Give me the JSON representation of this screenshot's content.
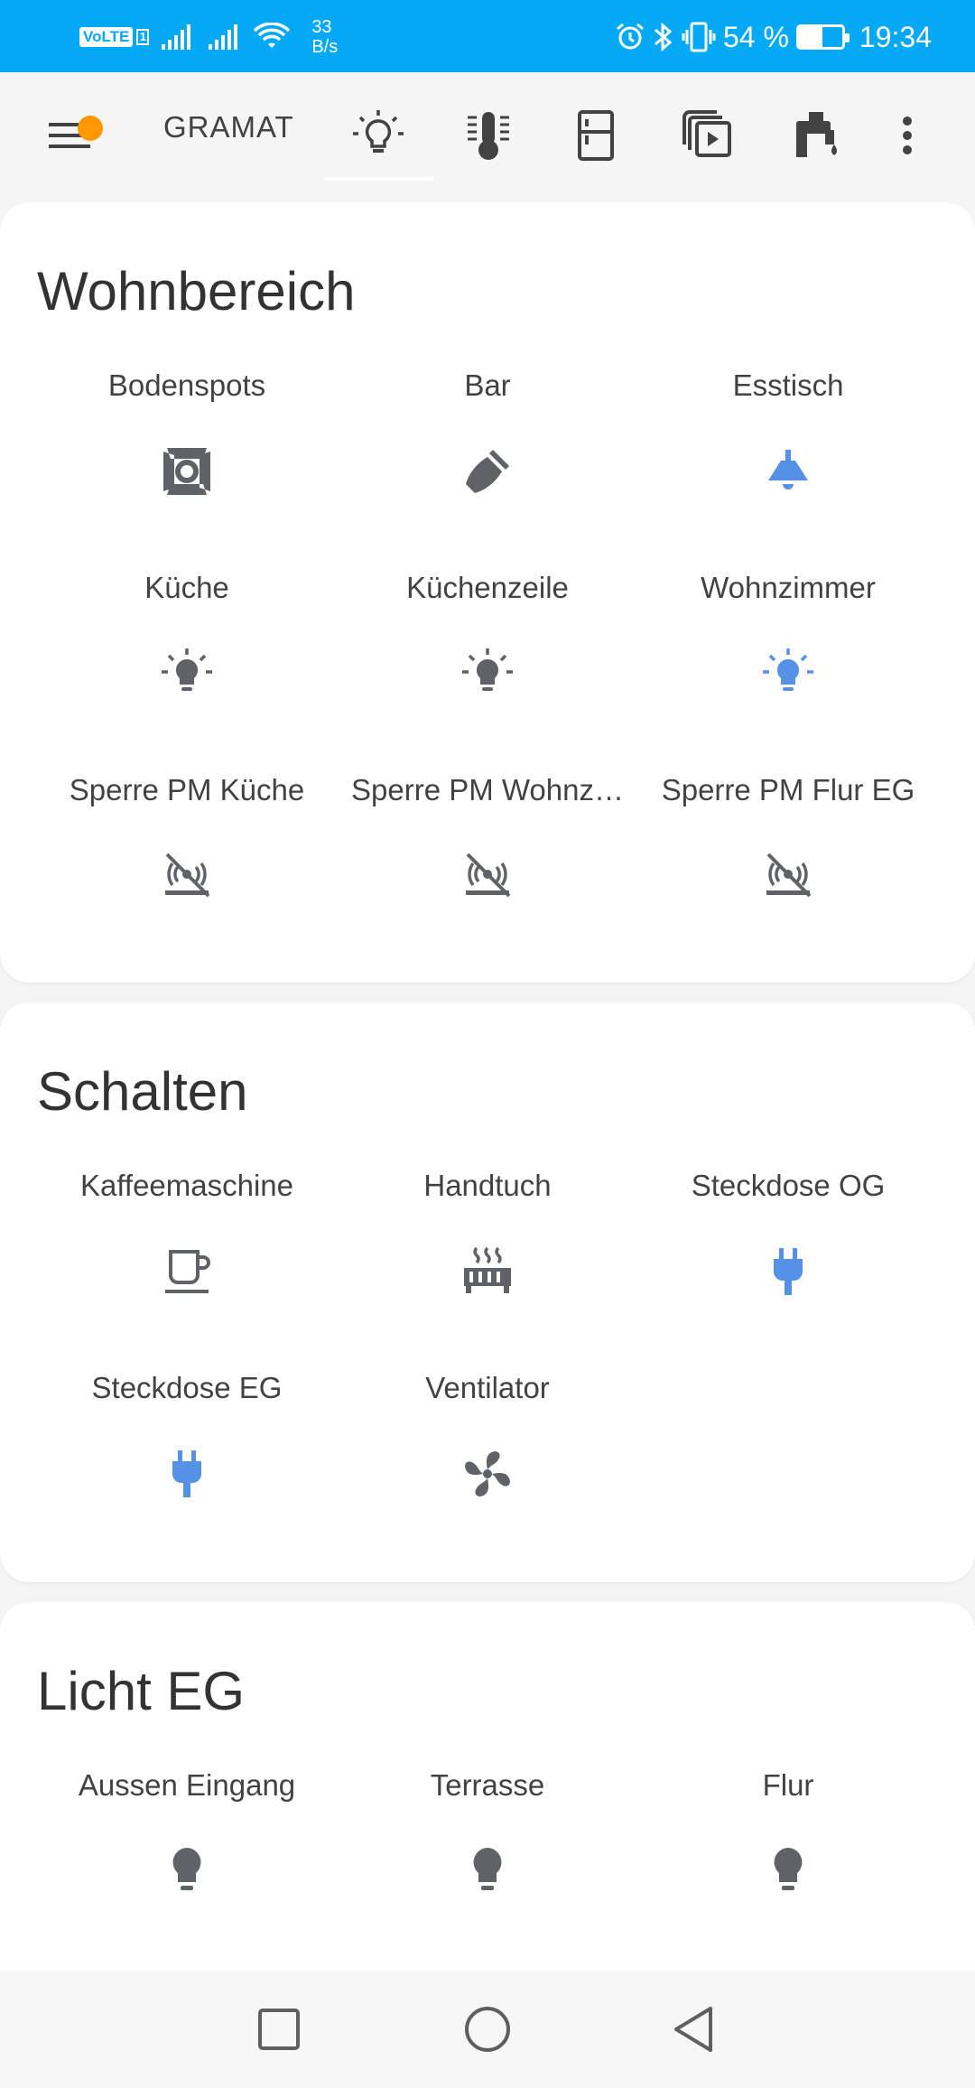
{
  "status_bar": {
    "volte": "VoLTE",
    "volte_sim": "1",
    "speed_value": "33",
    "speed_unit": "B/s",
    "battery_text": "54 %",
    "battery_level": 0.54,
    "time": "19:34"
  },
  "toolbar": {
    "title": "GRAMAT",
    "active_tab": "tab-lights",
    "tabs": [
      "lightbulb-outline-icon",
      "thermometer-icon",
      "fridge-icon",
      "media-icon",
      "water-pump-icon"
    ]
  },
  "sections": [
    {
      "title": "Wohnbereich",
      "entities": [
        {
          "label": "Bodenspots",
          "icon": "spotlight-icon",
          "color": "#5f6368"
        },
        {
          "label": "Bar",
          "icon": "broom-light-icon",
          "color": "#5f6368"
        },
        {
          "label": "Esstisch",
          "icon": "ceiling-light-icon",
          "color": "#5591e5"
        },
        {
          "label": "Küche",
          "icon": "lightbulb-on-icon",
          "color": "#5f6368"
        },
        {
          "label": "Küchenzeile",
          "icon": "lightbulb-on-icon",
          "color": "#5f6368"
        },
        {
          "label": "Wohnzimmer",
          "icon": "lightbulb-on-icon",
          "color": "#5591e5"
        },
        {
          "label": "Sperre PM Küche",
          "icon": "motion-sensor-off-icon",
          "color": "#5f6368"
        },
        {
          "label": "Sperre PM Wohnz…",
          "icon": "motion-sensor-off-icon",
          "color": "#5f6368"
        },
        {
          "label": "Sperre PM Flur EG",
          "icon": "motion-sensor-off-icon",
          "color": "#5f6368"
        }
      ]
    },
    {
      "title": "Schalten",
      "entities": [
        {
          "label": "Kaffeemaschine",
          "icon": "coffee-maker-icon",
          "color": "#5f6368"
        },
        {
          "label": "Handtuch",
          "icon": "radiator-icon",
          "color": "#5f6368"
        },
        {
          "label": "Steckdose OG",
          "icon": "power-plug-icon",
          "color": "#5591e5"
        },
        {
          "label": "Steckdose EG",
          "icon": "power-plug-icon",
          "color": "#5591e5"
        },
        {
          "label": "Ventilator",
          "icon": "fan-icon",
          "color": "#5f6368"
        }
      ]
    },
    {
      "title": "Licht EG",
      "entities": [
        {
          "label": "Aussen Eingang",
          "icon": "lightbulb-icon",
          "color": "#5f6368"
        },
        {
          "label": "Terrasse",
          "icon": "lightbulb-icon",
          "color": "#5f6368"
        },
        {
          "label": "Flur",
          "icon": "lightbulb-icon",
          "color": "#5f6368"
        }
      ]
    }
  ],
  "colors": {
    "status_bar": "#03a9f4",
    "accent_on": "#5591e5",
    "icon_off": "#5f6368",
    "badge": "#ff9800"
  }
}
